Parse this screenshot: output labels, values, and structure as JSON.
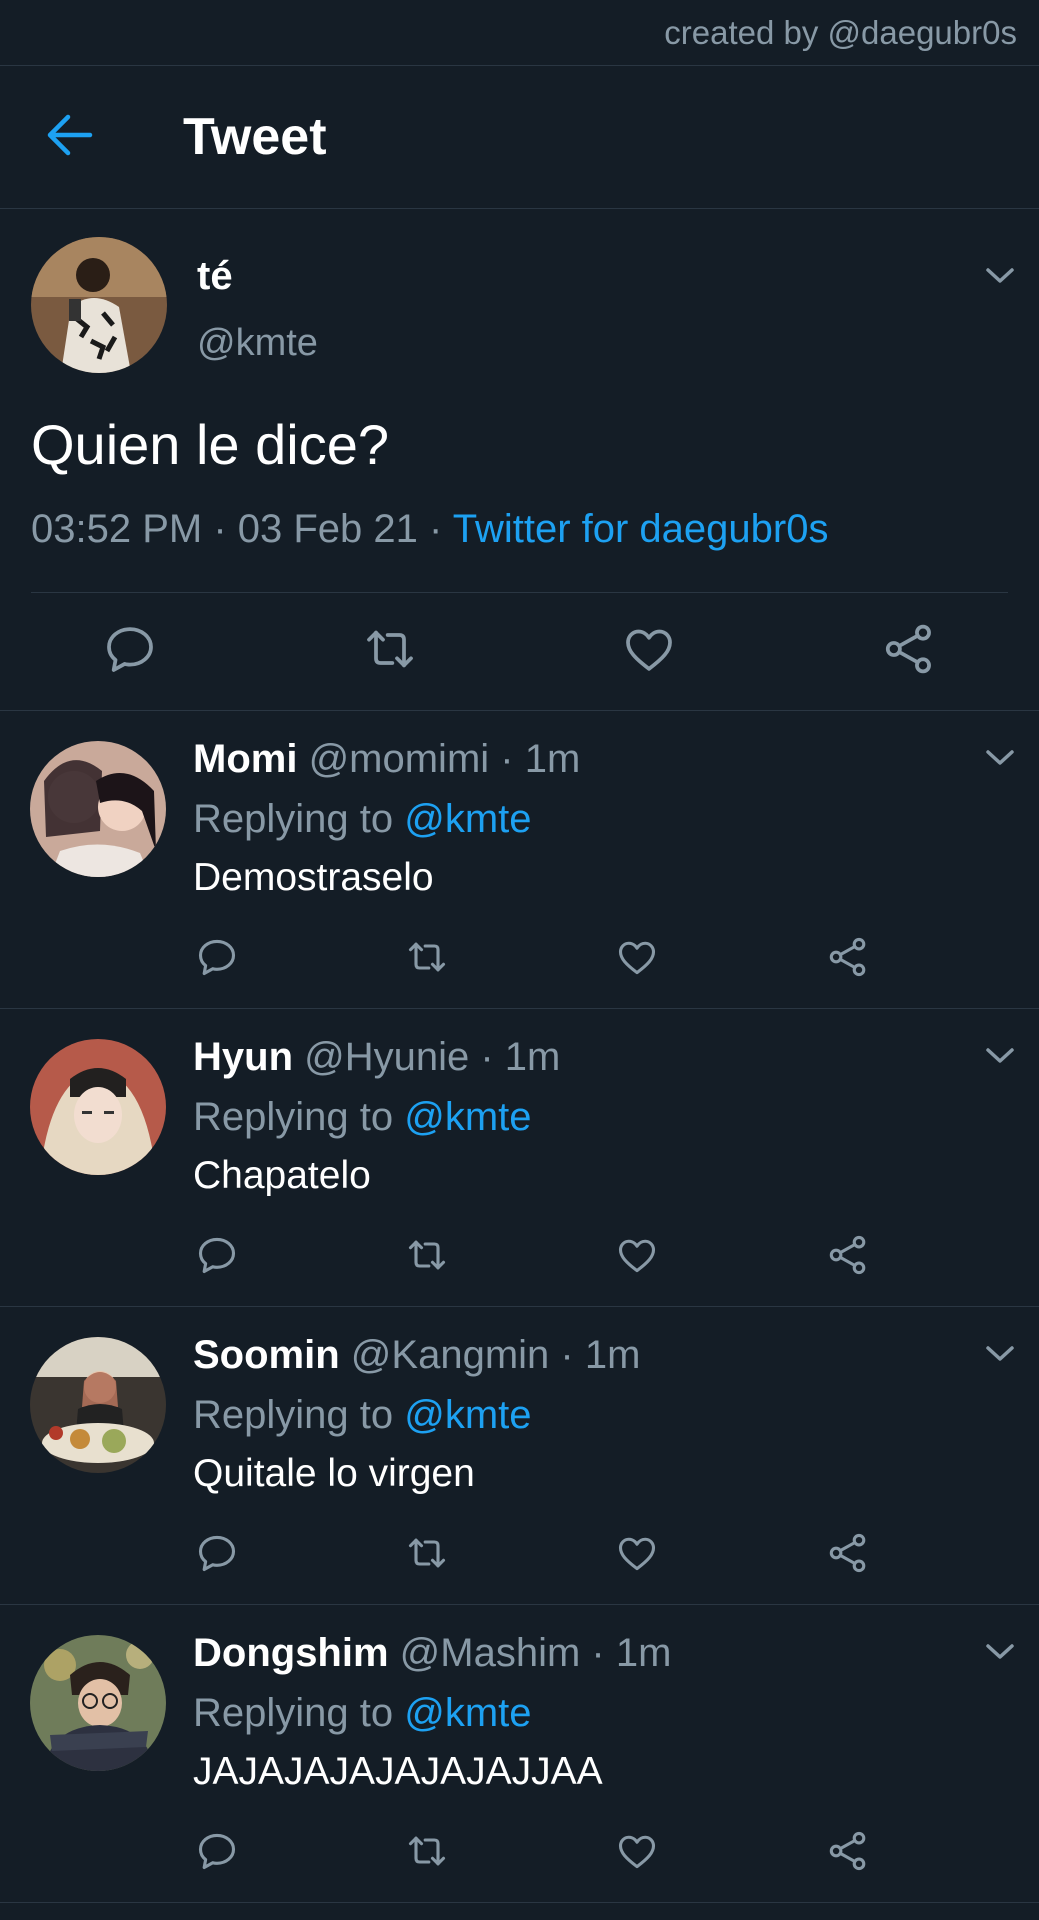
{
  "watermark": "created by @daegubr0s",
  "header": {
    "title": "Tweet"
  },
  "main_tweet": {
    "name": "té",
    "handle": "@kmte",
    "text": "Quien le dice?",
    "time": "03:52 PM",
    "date": "03 Feb 21",
    "source": "Twitter for daegubr0s"
  },
  "replies": [
    {
      "name": "Momi",
      "handle": "@momimi",
      "time": "1m",
      "replying_label": "Replying to",
      "replying_to": "@kmte",
      "text": "Demostraselo"
    },
    {
      "name": "Hyun",
      "handle": "@Hyunie",
      "time": "1m",
      "replying_label": "Replying to",
      "replying_to": "@kmte",
      "text": "Chapatelo"
    },
    {
      "name": "Soomin",
      "handle": "@Kangmin",
      "time": "1m",
      "replying_label": "Replying to",
      "replying_to": "@kmte",
      "text": "Quitale lo virgen"
    },
    {
      "name": "Dongshim",
      "handle": "@Mashim",
      "time": "1m",
      "replying_label": "Replying to",
      "replying_to": "@kmte",
      "text": "JAJAJAJAJAJAJAJJAA"
    }
  ],
  "colors": {
    "background": "#141d26",
    "accent": "#1da1f2",
    "muted": "#8899a6",
    "divider": "#2a3642"
  },
  "icons": [
    "back-arrow-icon",
    "chevron-down-icon",
    "reply-icon",
    "retweet-icon",
    "like-icon",
    "share-icon"
  ]
}
